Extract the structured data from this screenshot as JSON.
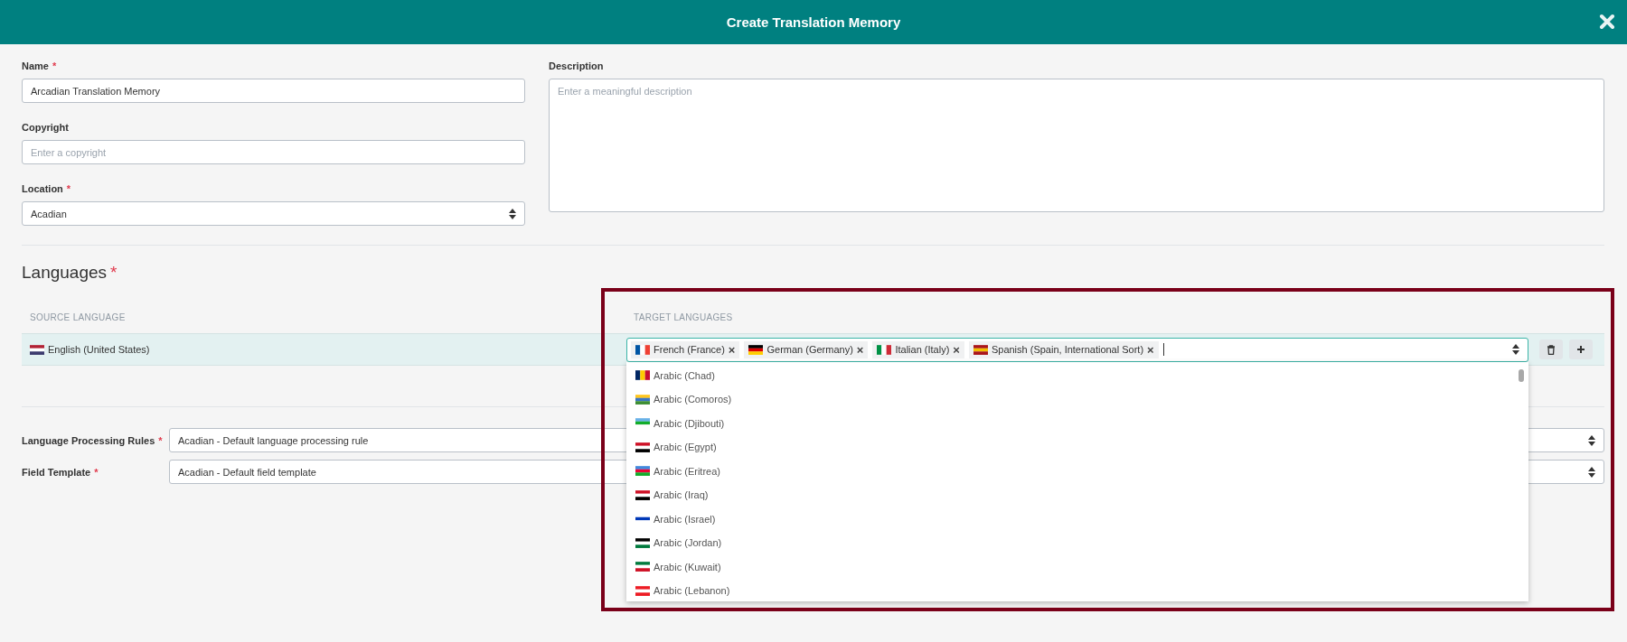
{
  "dialog": {
    "title": "Create Translation Memory"
  },
  "fields": {
    "name": {
      "label": "Name",
      "required_mark": "*",
      "value": "Arcadian Translation Memory"
    },
    "copyright": {
      "label": "Copyright",
      "placeholder": "Enter a copyright"
    },
    "location": {
      "label": "Location",
      "required_mark": "*",
      "value": "Acadian"
    },
    "description": {
      "label": "Description",
      "placeholder": "Enter a meaningful description"
    }
  },
  "languages": {
    "heading": "Languages",
    "required_mark": "*",
    "columns": [
      "SOURCE LANGUAGE",
      "TARGET LANGUAGES"
    ],
    "source": "English (United States)",
    "targets": [
      {
        "label": "French (France)",
        "remove": "×"
      },
      {
        "label": "German (Germany)",
        "remove": "×"
      },
      {
        "label": "Italian (Italy)",
        "remove": "×"
      },
      {
        "label": "Spanish (Spain, International Sort)",
        "remove": "×"
      }
    ],
    "options": [
      "Arabic (Chad)",
      "Arabic (Comoros)",
      "Arabic (Djibouti)",
      "Arabic (Egypt)",
      "Arabic (Eritrea)",
      "Arabic (Iraq)",
      "Arabic (Israel)",
      "Arabic (Jordan)",
      "Arabic (Kuwait)",
      "Arabic (Lebanon)"
    ]
  },
  "settings": [
    {
      "label": "Language Processing Rules",
      "required_mark": "*",
      "value": "Acadian - Default language processing rule"
    },
    {
      "label": "Field Template",
      "required_mark": "*",
      "value": "Acadian - Default field template"
    }
  ]
}
